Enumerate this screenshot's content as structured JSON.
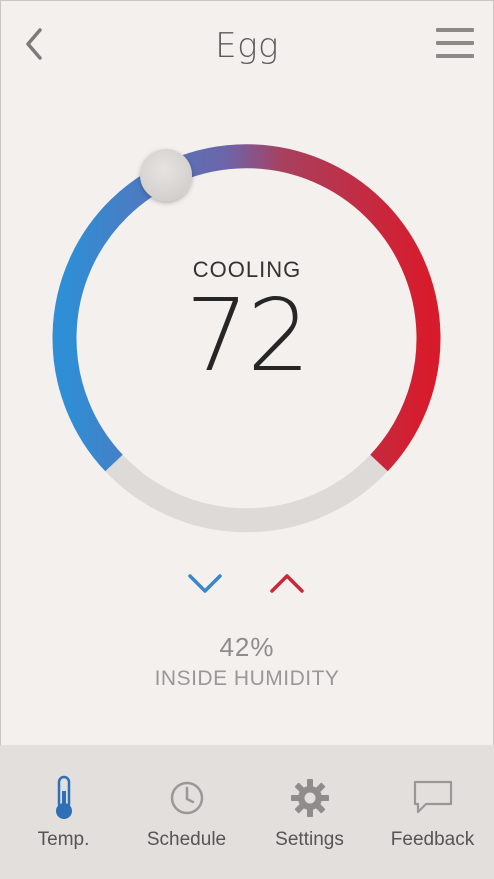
{
  "header": {
    "title": "Egg",
    "back_icon": "chevron-left-icon",
    "menu_icon": "hamburger-menu-icon"
  },
  "thermostat": {
    "mode": "COOLING",
    "setpoint": "72",
    "colors": {
      "cool": "#2e8fd6",
      "mid": "#7a5a9a",
      "heat": "#d81b2b",
      "track": "#dedad8"
    }
  },
  "controls": {
    "decrease_icon": "chevron-down-icon",
    "increase_icon": "chevron-up-icon",
    "decrease_color": "#3a86c8",
    "increase_color": "#c8283a"
  },
  "humidity": {
    "value": "42%",
    "label": "INSIDE HUMIDITY"
  },
  "tabs": [
    {
      "label": "Temp.",
      "icon": "thermometer-icon",
      "active": true
    },
    {
      "label": "Schedule",
      "icon": "clock-icon",
      "active": false
    },
    {
      "label": "Settings",
      "icon": "gear-icon",
      "active": false
    },
    {
      "label": "Feedback",
      "icon": "speech-bubble-icon",
      "active": false
    }
  ]
}
